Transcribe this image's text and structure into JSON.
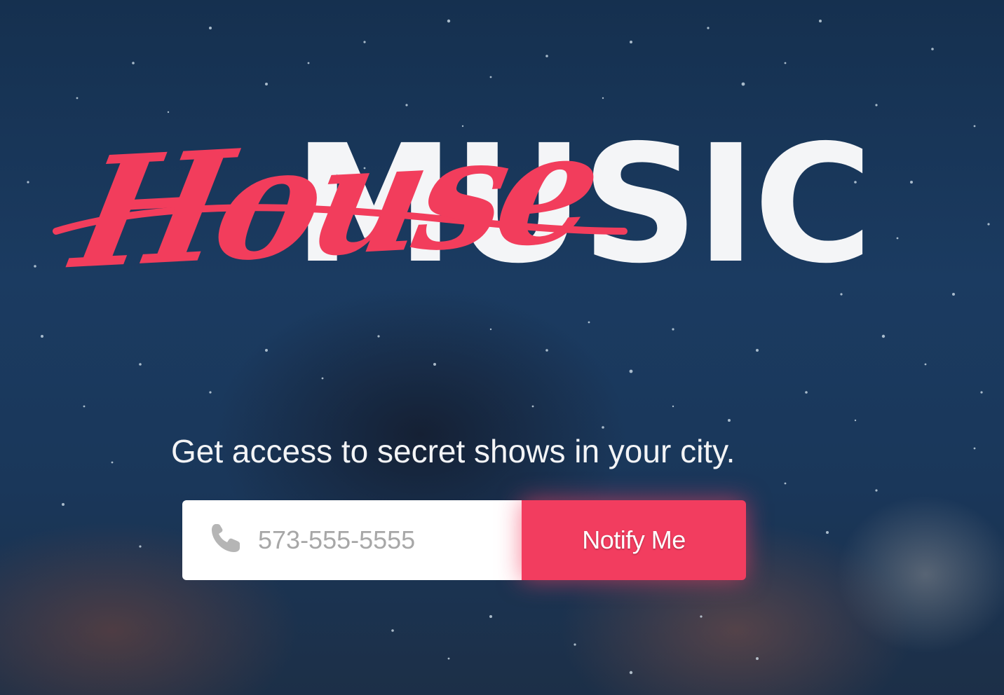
{
  "hero": {
    "title_script": "House",
    "title_block": "MUSIC",
    "tagline": "Get access to secret shows in your city."
  },
  "signup_form": {
    "phone_placeholder": "573-555-5555",
    "phone_value": "",
    "phone_icon": "phone-icon",
    "submit_label": "Notify Me"
  },
  "colors": {
    "accent": "#f23d5f",
    "title_white": "#f4f5f7",
    "background": "#163354"
  }
}
